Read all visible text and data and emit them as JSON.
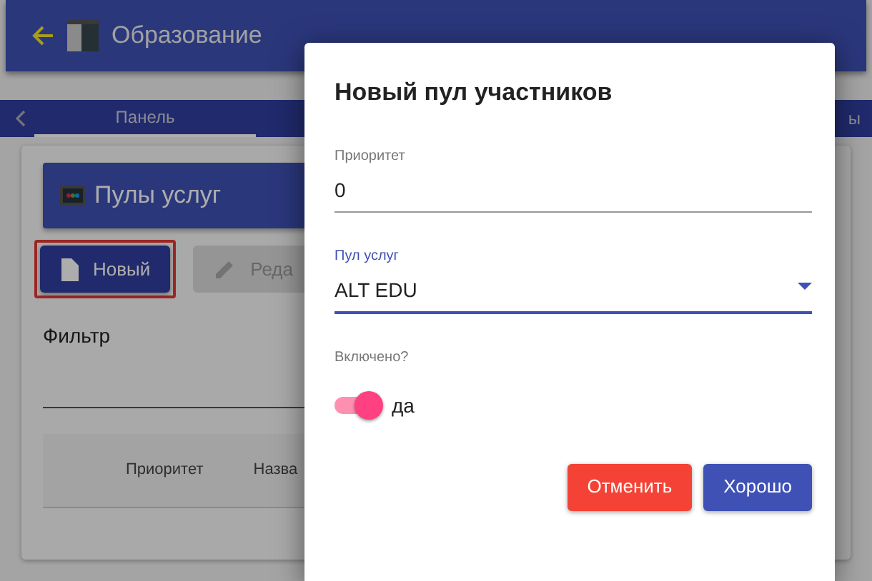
{
  "app_bar": {
    "title": "Образование"
  },
  "tabs": [
    {
      "label": "Панель",
      "selected": true
    },
    {
      "label": "ы",
      "selected": false
    }
  ],
  "card": {
    "title": "Пулы услуг"
  },
  "toolbar": [
    {
      "label": "Новый",
      "disabled": false,
      "highlighted": true
    },
    {
      "label": "Реда",
      "disabled": true,
      "highlighted": false
    }
  ],
  "filter": {
    "label": "Фильтр"
  },
  "table": {
    "columns": [
      "Приоритет",
      "Назва"
    ]
  },
  "dialog": {
    "title": "Новый пул участников",
    "priority": {
      "label": "Приоритет",
      "value": "0",
      "focused": false
    },
    "pool": {
      "label": "Пул услуг",
      "value": "ALT EDU",
      "focused": true
    },
    "enabled": {
      "label": "Включено?",
      "on": true,
      "text": "да"
    },
    "buttons": [
      {
        "label": "Отменить",
        "kind": "cancel"
      },
      {
        "label": "Хорошо",
        "kind": "ok"
      }
    ]
  }
}
